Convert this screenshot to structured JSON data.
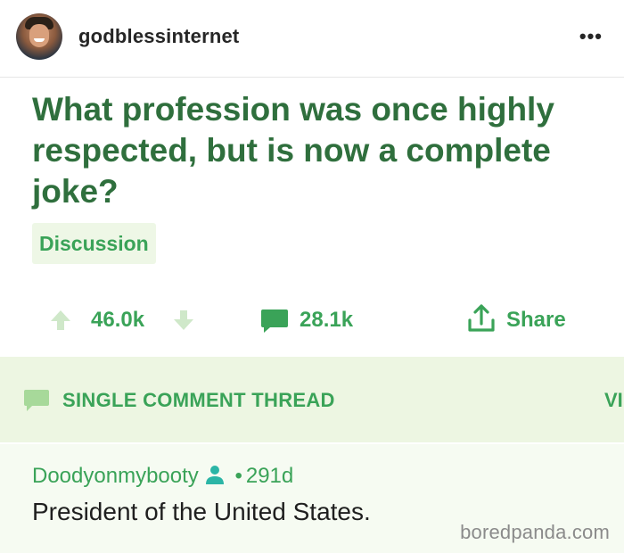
{
  "header": {
    "username": "godblessinternet",
    "more_icon": "more-horizontal-icon"
  },
  "post": {
    "title": "What profession was once highly respected, but is now a complete joke?",
    "flair": "Discussion",
    "votes": "46.0k",
    "comments": "28.1k",
    "share_label": "Share"
  },
  "thread": {
    "label": "SINGLE COMMENT THREAD",
    "view_link": "VI"
  },
  "comment": {
    "author": "Doodyonmybooty",
    "separator": "•",
    "age": "291d",
    "body": "President of the United States."
  },
  "watermark": "boredpanda.com",
  "colors": {
    "accent": "#3aa358",
    "title": "#2f6f3d",
    "thread_bg": "#edf6e2",
    "comment_bg": "#f6fbf2"
  }
}
